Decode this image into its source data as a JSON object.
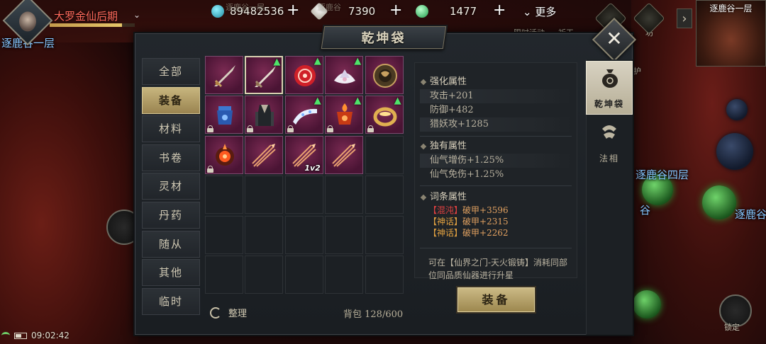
{
  "top_bar": {
    "player_name": "大罗金仙后期",
    "hp_fraction": 0.85,
    "currencies": [
      {
        "icon": "spirit-stone-icon",
        "value": "89482536",
        "color": "#3ec8d8"
      },
      {
        "icon": "jade-icon",
        "value": "7390",
        "color": "#e6e3d6"
      },
      {
        "icon": "green-gem-icon",
        "value": "1477",
        "color": "#3fbf6a"
      }
    ],
    "more_label": "更多",
    "ghost_labels": [
      "逐鹿谷一层",
      "逐鹿谷",
      "限时活动",
      "祈天",
      "坊",
      "神护"
    ],
    "minimap_title": "逐鹿谷一层"
  },
  "map_labels": [
    "逐鹿谷一层",
    "逐鹿谷四层",
    "谷",
    "逐鹿谷"
  ],
  "panel": {
    "title": "乾坤袋"
  },
  "categories": [
    {
      "label": "全部",
      "active": false
    },
    {
      "label": "装备",
      "active": true
    },
    {
      "label": "材料",
      "active": false
    },
    {
      "label": "书卷",
      "active": false
    },
    {
      "label": "灵材",
      "active": false
    },
    {
      "label": "丹药",
      "active": false
    },
    {
      "label": "随从",
      "active": false
    },
    {
      "label": "其他",
      "active": false
    },
    {
      "label": "临时",
      "active": false
    }
  ],
  "items": [
    {
      "name": "sword-item",
      "upgrade": false,
      "locked": false,
      "selected": false,
      "count": ""
    },
    {
      "name": "sword-item-alt",
      "upgrade": true,
      "locked": false,
      "selected": true,
      "count": ""
    },
    {
      "name": "red-mandala-item",
      "upgrade": true,
      "locked": false,
      "selected": false,
      "count": ""
    },
    {
      "name": "white-lotus-crown-item",
      "upgrade": true,
      "locked": false,
      "selected": false,
      "count": ""
    },
    {
      "name": "dragon-medallion-item",
      "upgrade": false,
      "locked": false,
      "selected": false,
      "count": ""
    },
    {
      "name": "blue-cauldron-item",
      "upgrade": false,
      "locked": true,
      "selected": false,
      "count": ""
    },
    {
      "name": "dark-robe-item",
      "upgrade": false,
      "locked": true,
      "selected": false,
      "count": ""
    },
    {
      "name": "sash-item",
      "upgrade": true,
      "locked": true,
      "selected": false,
      "count": ""
    },
    {
      "name": "fire-cauldron-item",
      "upgrade": true,
      "locked": true,
      "selected": false,
      "count": ""
    },
    {
      "name": "gold-ring-item",
      "upgrade": true,
      "locked": true,
      "selected": false,
      "count": ""
    },
    {
      "name": "flame-orb-item",
      "upgrade": false,
      "locked": true,
      "selected": false,
      "count": ""
    },
    {
      "name": "feather-arrows-item",
      "upgrade": false,
      "locked": false,
      "selected": false,
      "count": ""
    },
    {
      "name": "feather-arrows-item",
      "upgrade": false,
      "locked": false,
      "selected": false,
      "count": "1v2"
    },
    {
      "name": "feather-arrows-item",
      "upgrade": false,
      "locked": false,
      "selected": false,
      "count": ""
    }
  ],
  "grid_total_slots": 30,
  "footer": {
    "sort_label": "整理",
    "capacity_label": "背包 128/600"
  },
  "details": {
    "enhance": {
      "title": "强化属性",
      "rows": [
        "攻击+201",
        "防御+482",
        "猎妖攻+1285"
      ]
    },
    "unique": {
      "title": "独有属性",
      "rows": [
        "仙气增伤+1.25%",
        "仙气免伤+1.25%"
      ]
    },
    "affix": {
      "title": "词条属性",
      "rows": [
        {
          "tag": "【混沌】",
          "tag_color": "red",
          "value": "破甲+3596"
        },
        {
          "tag": "【神话】",
          "tag_color": "gold",
          "value": "破甲+2315"
        },
        {
          "tag": "【神话】",
          "tag_color": "gold",
          "value": "破甲+2262"
        }
      ]
    },
    "note": "可在【仙界之门-天火锻铸】消耗同部位同品质仙器进行升星"
  },
  "equip_button_label": "装备",
  "side_tabs": [
    {
      "label": "乾坤袋",
      "active": true,
      "icon": "bag-icon"
    },
    {
      "label": "法相",
      "active": false,
      "icon": "avatar-form-icon"
    }
  ],
  "status": {
    "time": "09:02:42"
  },
  "lock_button_label": "锁定"
}
